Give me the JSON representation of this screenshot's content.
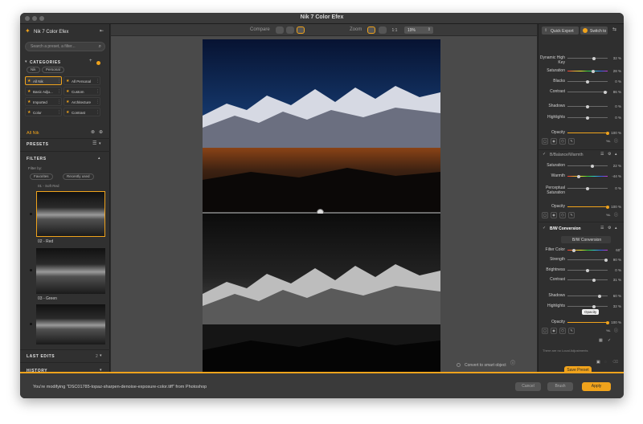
{
  "window": {
    "title": "Nik 7 Color Efex"
  },
  "left": {
    "app_name": "Nik 7 Color Efex",
    "search_placeholder": "Search a preset, a filter...",
    "categories_label": "CATEGORIES",
    "cat_tabs": [
      "Nik",
      "Personal"
    ],
    "categories": [
      {
        "name": "All Nik",
        "active": true
      },
      {
        "name": "All Personal",
        "active": false
      },
      {
        "name": "Basic Adju...",
        "active": false
      },
      {
        "name": "Custom",
        "active": false
      },
      {
        "name": "Imported",
        "active": false
      },
      {
        "name": "Architecture",
        "active": false
      },
      {
        "name": "Color",
        "active": false
      },
      {
        "name": "Contrast",
        "active": false
      }
    ],
    "current_category": "All Nik",
    "presets_label": "PRESETS",
    "filters_label": "FILTERS",
    "filter_by_label": "Filter by:",
    "filter_chips": [
      "Favorites",
      "Recently used"
    ],
    "filter_items": [
      "01 - Soft Red",
      "02 - Red",
      "03 - Green"
    ],
    "last_edits_label": "LAST EDITS",
    "last_edits_count": "2",
    "history_label": "HISTORY"
  },
  "toolbar": {
    "compare_label": "Compare",
    "zoom_label": "Zoom",
    "zoom_ratio": "1:1",
    "zoom_value": "19%"
  },
  "center": {
    "convert_label": "Convert to smart object"
  },
  "right": {
    "quick_export_label": "Quick Export",
    "switch_label": "Switch to",
    "pro_contrast_sliders": [
      {
        "label": "Dynamic High Key",
        "value": "32 %"
      },
      {
        "label": "Saturation",
        "value": "28 %"
      },
      {
        "label": "Blacks",
        "value": "0 %"
      },
      {
        "label": "Contrast",
        "value": "86 %"
      },
      {
        "label": "Shadows",
        "value": "0 %"
      },
      {
        "label": "Highlights",
        "value": "0 %"
      },
      {
        "label": "Opacity",
        "value": "100 %"
      }
    ],
    "warmth_title": "B/Balance/Warmth",
    "warmth_sliders": [
      {
        "label": "Saturation",
        "value": "22 %"
      },
      {
        "label": "Warmth",
        "value": "-44 %"
      },
      {
        "label": "Perceptual Saturation",
        "value": "0 %"
      },
      {
        "label": "Opacity",
        "value": "100 %"
      }
    ],
    "bw_title": "B/W Conversion",
    "bw_dropdown": "B/W Conversion",
    "bw_sliders": [
      {
        "label": "Filter Color",
        "value": "60°"
      },
      {
        "label": "Strength",
        "value": "90 %"
      },
      {
        "label": "Brightness",
        "value": "0 %"
      },
      {
        "label": "Contrast",
        "value": "31 %"
      },
      {
        "label": "Shadows",
        "value": "60 %"
      },
      {
        "label": "Highlights",
        "value": "32 %"
      },
      {
        "label": "Opacity",
        "value": "100 %"
      }
    ],
    "tooltip": "Opacity",
    "local_adjustments_text": "There are no Local Adjustments",
    "save_preset_label": "Save Preset"
  },
  "bottom": {
    "message": "You're modifying \"DSC01785-topaz-sharpen-denoise-exposure-color.tiff\" from Photoshop",
    "cancel_label": "Cancel",
    "brush_label": "Brush",
    "apply_label": "Apply"
  },
  "colors": {
    "accent": "#f0a31c",
    "panel": "#303030",
    "canvas": "#4a4a4a"
  }
}
